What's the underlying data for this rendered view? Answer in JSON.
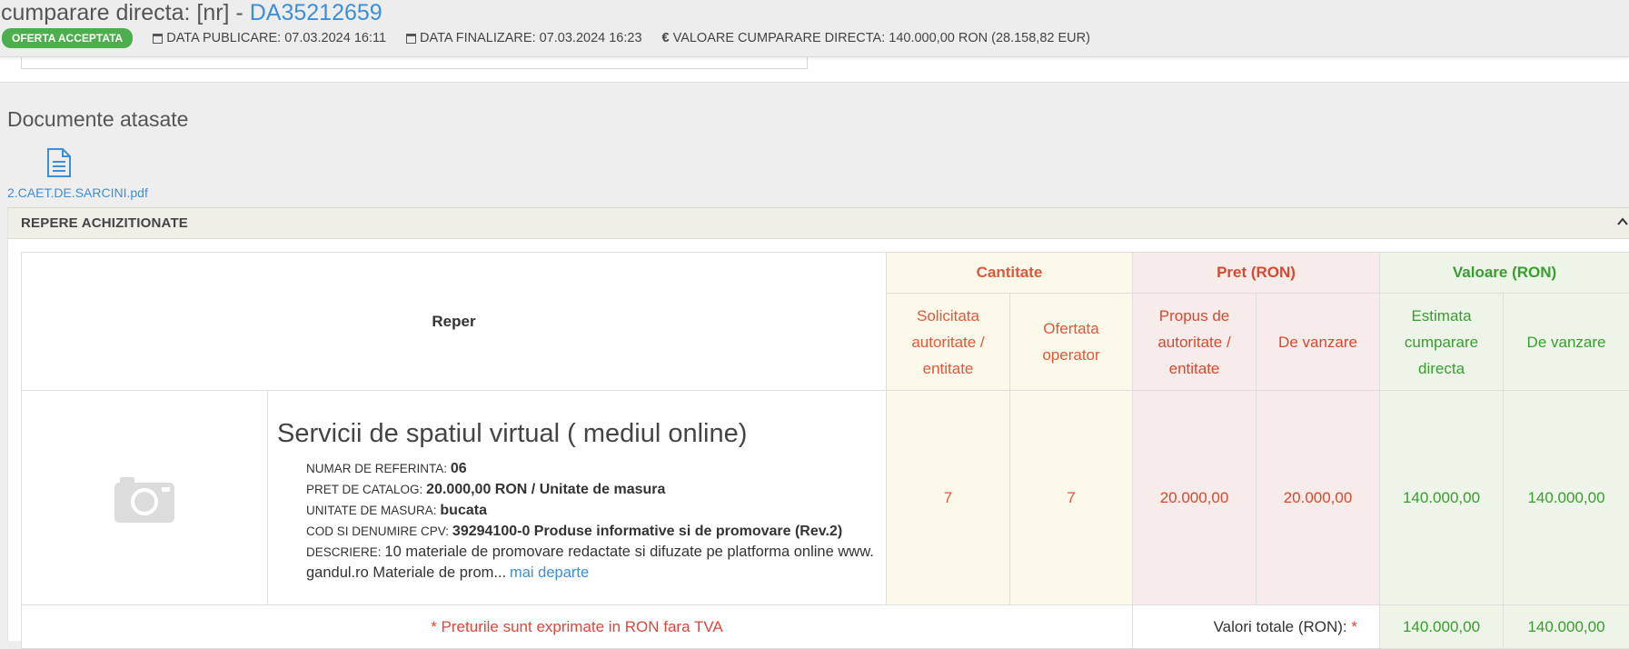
{
  "header": {
    "title_prefix": "cumparare directa: [nr] - ",
    "code": "DA35212659",
    "status_badge": "OFERTA ACCEPTATA",
    "publish_label": "DATA PUBLICARE: 07.03.2024 16:11",
    "finish_label": "DATA FINALIZARE: 07.03.2024 16:23",
    "value_label": "VALOARE CUMPARARE DIRECTA: 140.000,00  RON (28.158,82  EUR)"
  },
  "documents": {
    "title": "Documente atasate",
    "files": [
      {
        "name": "2.CAET.DE.SARCINI.pdf",
        "icon": "document-icon"
      }
    ]
  },
  "section": {
    "title": "REPERE ACHIZITIONATE",
    "toggle_icon": "chevron-up-icon"
  },
  "table": {
    "head": {
      "reper": "Reper",
      "cantitate": "Cantitate",
      "pret": "Pret (RON)",
      "valoare": "Valoare (RON)",
      "solicitata": "Solicitata autoritate / entitate",
      "ofertata": "Ofertata operator",
      "propus": "Propus de autoritate / entitate",
      "de_vanzare_pret": "De vanzare",
      "estimata": "Estimata cumparare directa",
      "de_vanzare_valoare": "De vanzare"
    },
    "row": {
      "image_icon": "camera-icon",
      "title": "Servicii de spatiul virtual ( mediul online)",
      "ref_label": "NUMAR DE REFERINTA:",
      "ref_value": "06",
      "catalog_label": "PRET DE CATALOG:",
      "catalog_value": "20.000,00  RON / Unitate de masura",
      "unit_label": "UNITATE DE MASURA:",
      "unit_value": "bucata",
      "cpv_label": "COD SI DENUMIRE CPV:",
      "cpv_value": "39294100-0 Produse informative si de promovare (Rev.2)",
      "desc_label": "DESCRIERE:",
      "desc_value": "10 materiale de promovare redactate si difuzate pe platforma online www.gandul.ro Materiale de prom...",
      "more_link": "mai departe",
      "qty_requested": "7",
      "qty_offered": "7",
      "price_proposed": "20.000,00",
      "price_sale": "20.000,00",
      "value_estimated": "140.000,00",
      "value_sale": "140.000,00"
    },
    "footer": {
      "note": "* Preturile sunt exprimate in RON fara TVA",
      "totals_label": "Valori totale (RON):",
      "totals_star": "*",
      "total_estimated": "140.000,00",
      "total_sale": "140.000,00"
    }
  },
  "colors": {
    "accent_blue": "#3a8fd8",
    "badge_green": "#4cae4c",
    "qty_text": "#e0573a",
    "price_text": "#d84830",
    "value_text": "#3a9d2f"
  }
}
